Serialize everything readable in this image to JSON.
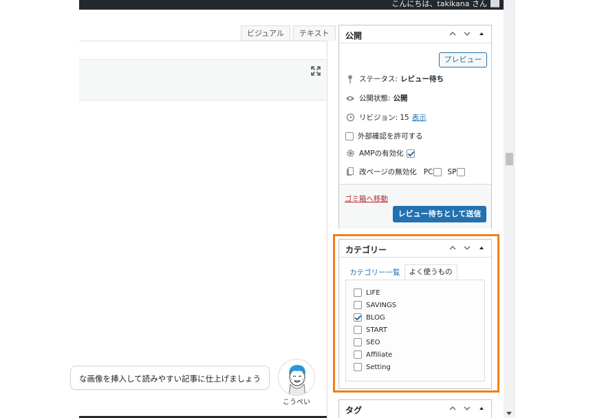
{
  "admin_bar": {
    "greeting": "こんにちは、takikana さん"
  },
  "editor": {
    "tabs": [
      {
        "label": "ビジュアル"
      },
      {
        "label": "テキスト"
      }
    ],
    "tip": "な画像を挿入して読みやすい記事に仕上げましょう",
    "mascot_name": "こうぺい"
  },
  "publish": {
    "title": "公開",
    "preview_label": "プレビュー",
    "status_label": "ステータス:",
    "status_value": "レビュー待ち",
    "visibility_label": "公開状態:",
    "visibility_value": "公開",
    "revisions_label": "リビジョン: 15",
    "revisions_link": "表示",
    "external_check_label": "外部確認を許可する",
    "amp_label": "AMPの有効化",
    "amp_checked": true,
    "pagebreak_label": "改ページの無効化",
    "pc_label": "PC",
    "sp_label": "SP",
    "trash_label": "ゴミ箱へ移動",
    "submit_label": "レビュー待ちとして送信"
  },
  "category": {
    "title": "カテゴリー",
    "tab_all": "カテゴリー一覧",
    "tab_popular": "よく使うもの",
    "items": [
      {
        "label": "LIFE",
        "checked": false
      },
      {
        "label": "SAVINGS",
        "checked": false
      },
      {
        "label": "BLOG",
        "checked": true
      },
      {
        "label": "START",
        "checked": false
      },
      {
        "label": "SEO",
        "checked": false
      },
      {
        "label": "Affiliate",
        "checked": false
      },
      {
        "label": "Setting",
        "checked": false
      }
    ]
  },
  "tags": {
    "title": "タグ"
  },
  "colors": {
    "accent": "#2271b1",
    "highlight": "#f07f16",
    "danger": "#b32d2e",
    "adminbar": "#23282d"
  }
}
